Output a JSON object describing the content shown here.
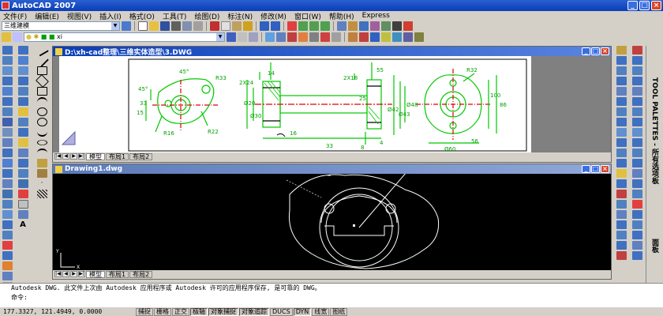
{
  "app": {
    "title": "AutoCAD 2007"
  },
  "window_buttons": {
    "minimize": "_",
    "maximize": "□",
    "close": "×"
  },
  "menu": [
    "文件(F)",
    "编辑(E)",
    "视图(V)",
    "插入(I)",
    "格式(O)",
    "工具(T)",
    "绘图(D)",
    "标注(N)",
    "修改(M)",
    "窗口(W)",
    "帮助(H)",
    "Express"
  ],
  "toolbar": {
    "workspace": "三维建模",
    "layer": "xi"
  },
  "doc1": {
    "title": "D:\\xh-cad整理\\三维实体造型\\3.DWG",
    "tabs": [
      "模型",
      "布局1",
      "布局2"
    ],
    "dims": {
      "a45": "45°",
      "r33": "R33",
      "a45b": "45°",
      "d33": "33",
      "d15": "15",
      "r16": "R16",
      "r22": "R22",
      "d2x24": "2X24",
      "d2x18": "2X18",
      "d14": "14",
      "d55": "55",
      "d20": "Ø20",
      "d30": "Ø30",
      "d42": "Ø42",
      "d43": "Ø43",
      "d48": "Ø48",
      "d25": "25",
      "d16": "16",
      "d33b": "33",
      "r32": "R32",
      "d60": "Ø60",
      "d86": "86",
      "d100": "100",
      "d56": "56",
      "d4": "4",
      "d8": "8"
    }
  },
  "doc2": {
    "title": "Drawing1.dwg",
    "tabs": [
      "模型",
      "布局1",
      "布局2"
    ],
    "axis_y": "Y",
    "axis_x": "X"
  },
  "right_panel": {
    "tool_palettes": "TOOL PALETTES - 所有选项板",
    "face": "面板"
  },
  "command": {
    "line1": "Autodesk DWG.    此文件上次由 Autodesk 应用程序或 Autodesk 许可的应用程序保存, 是可靠的 DWG。",
    "prompt": "命令:"
  },
  "status": {
    "coords": "177.3327, 121.4949, 0.0000",
    "toggles": [
      {
        "label": "捕捉",
        "on": false
      },
      {
        "label": "栅格",
        "on": false
      },
      {
        "label": "正交",
        "on": false
      },
      {
        "label": "极轴",
        "on": true
      },
      {
        "label": "对象捕捉",
        "on": true
      },
      {
        "label": "对象追踪",
        "on": true
      },
      {
        "label": "DUCS",
        "on": false
      },
      {
        "label": "DYN",
        "on": true
      },
      {
        "label": "线宽",
        "on": false
      },
      {
        "label": "图纸",
        "on": false
      }
    ]
  },
  "colors": {
    "title_blue": "#0a3db8",
    "drawing_green": "#00c800",
    "drawing_red": "#e00000",
    "model_bg": "#000000",
    "paper_bg": "#ffffff"
  }
}
